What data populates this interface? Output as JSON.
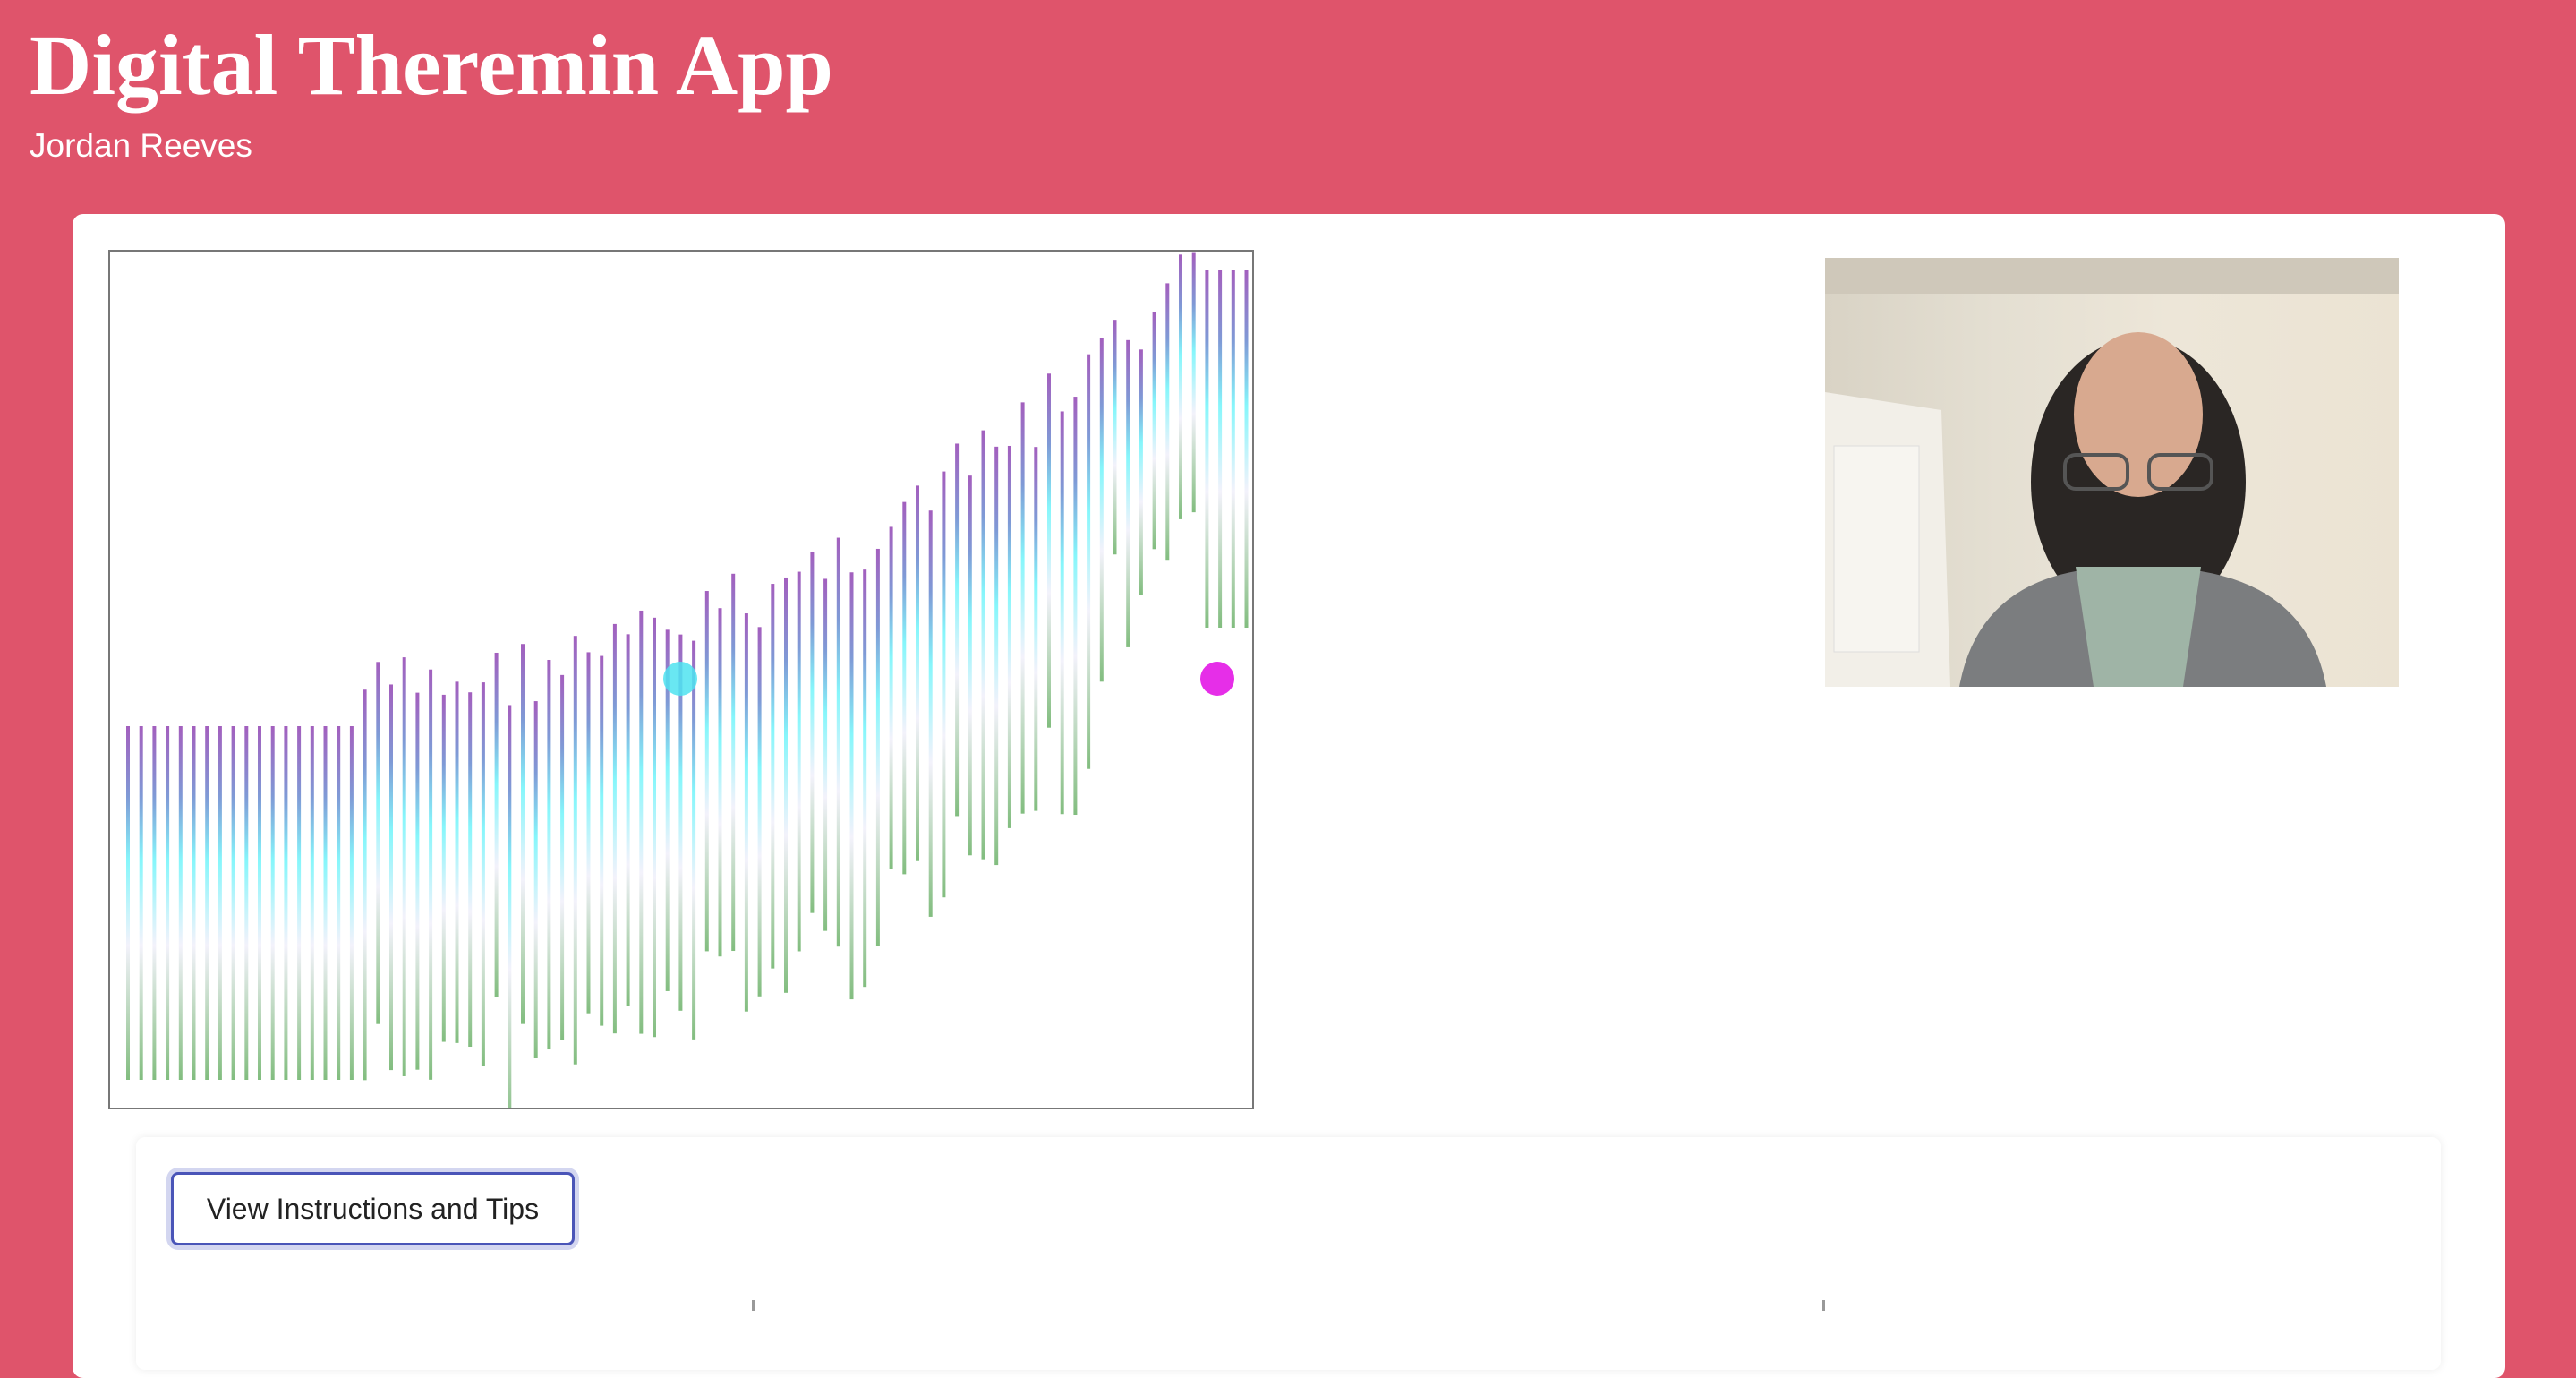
{
  "header": {
    "title": "Digital Theremin App",
    "author": "Jordan Reeves"
  },
  "controls": {
    "instructions_button": "View Instructions and Tips"
  },
  "visualizer": {
    "left_hand_color": "#4fe3f0",
    "right_hand_color": "#e62ee8"
  },
  "colors": {
    "background": "#df546b"
  }
}
